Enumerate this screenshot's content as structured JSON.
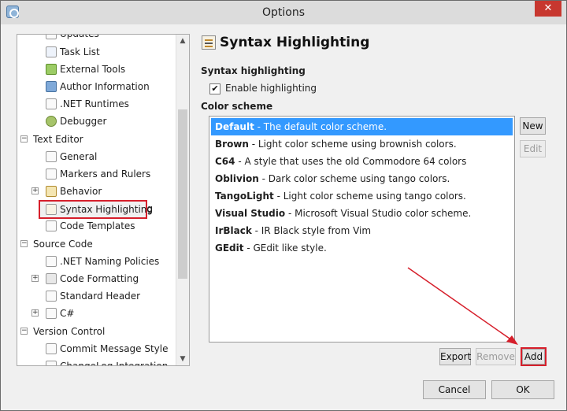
{
  "window": {
    "title": "Options",
    "close_glyph": "✕"
  },
  "tree": {
    "items": [
      {
        "label": "Updates",
        "icon": "updates-icon"
      },
      {
        "label": "Task List",
        "icon": "task-list-icon"
      },
      {
        "label": "External Tools",
        "icon": "external-tools-icon"
      },
      {
        "label": "Author Information",
        "icon": "author-icon"
      },
      {
        "label": ".NET Runtimes",
        "icon": "runtimes-icon"
      },
      {
        "label": "Debugger",
        "icon": "debugger-icon"
      },
      {
        "label": "Text Editor",
        "category": true
      },
      {
        "label": "General",
        "icon": "general-icon"
      },
      {
        "label": "Markers and Rulers",
        "icon": "markers-icon"
      },
      {
        "label": "Behavior",
        "icon": "behavior-icon"
      },
      {
        "label": "Syntax Highlighting",
        "icon": "syntax-icon",
        "selected": true
      },
      {
        "label": "Code Templates",
        "icon": "templates-icon"
      },
      {
        "label": "Source Code",
        "category": true
      },
      {
        "label": ".NET Naming Policies",
        "icon": "naming-icon"
      },
      {
        "label": "Code Formatting",
        "icon": "formatting-icon"
      },
      {
        "label": "Standard Header",
        "icon": "header-icon"
      },
      {
        "label": "C#",
        "icon": "csharp-icon"
      },
      {
        "label": "Version Control",
        "category": true
      },
      {
        "label": "Commit Message Style",
        "icon": "commit-icon"
      },
      {
        "label": "ChangeLog Integration",
        "icon": "changelog-icon"
      }
    ]
  },
  "panel": {
    "title": "Syntax Highlighting",
    "section_highlighting": "Syntax highlighting",
    "enable_label": "Enable highlighting",
    "enable_checked": "✔",
    "section_scheme": "Color scheme"
  },
  "schemes": [
    {
      "name": "Default",
      "desc": " - The default color scheme."
    },
    {
      "name": "Brown",
      "desc": " - Light color scheme using brownish colors."
    },
    {
      "name": "C64",
      "desc": " - A style that uses the old Commodore 64 colors"
    },
    {
      "name": "Oblivion",
      "desc": " - Dark color scheme using tango colors."
    },
    {
      "name": "TangoLight",
      "desc": " - Light color scheme using tango colors."
    },
    {
      "name": "Visual Studio",
      "desc": " - Microsoft Visual Studio color scheme."
    },
    {
      "name": "IrBlack",
      "desc": " - IR Black style from Vim"
    },
    {
      "name": "GEdit",
      "desc": " - GEdit like style."
    }
  ],
  "buttons": {
    "new": "New",
    "edit": "Edit",
    "export": "Export",
    "remove": "Remove",
    "add": "Add",
    "cancel": "Cancel",
    "ok": "OK"
  },
  "colors": {
    "selection": "#3399ff",
    "highlight": "#d61f2b"
  }
}
